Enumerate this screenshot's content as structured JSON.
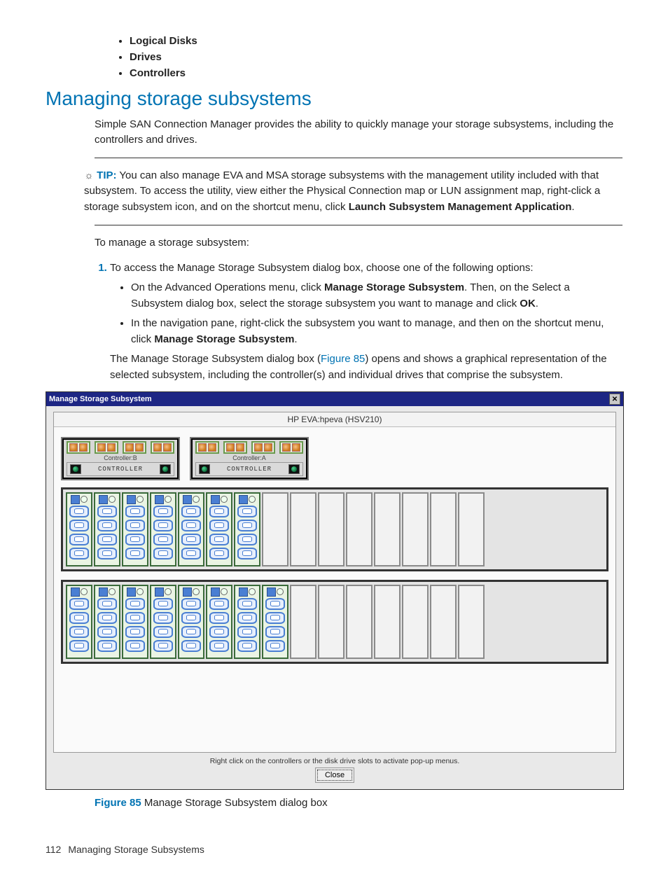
{
  "top_bullets": [
    "Logical Disks",
    "Drives",
    "Controllers"
  ],
  "heading": "Managing storage subsystems",
  "intro": "Simple SAN Connection Manager provides the ability to quickly manage your storage subsystems, including the controllers and drives.",
  "tip": {
    "label": "TIP:",
    "pre": "You can also manage EVA and MSA storage subsystems with the management utility included with that subsystem. To access the utility, view either the Physical Connection map or LUN assignment map, right-click a storage subsystem icon, and on the shortcut menu, click ",
    "bold": "Launch Subsystem Management Application",
    "post": "."
  },
  "lead": "To manage a storage subsystem:",
  "step1": "To access the Manage Storage Subsystem dialog box, choose one of the following options:",
  "sub1": {
    "a": "On the Advanced Operations menu, click ",
    "b": "Manage Storage Subsystem",
    "c": ". Then, on the Select a Subsystem dialog box, select the storage subsystem you want to manage and click ",
    "d": "OK",
    "e": "."
  },
  "sub2": {
    "a": "In the navigation pane, right-click the subsystem you want to manage, and then on the shortcut menu, click ",
    "b": "Manage Storage Subsystem",
    "c": "."
  },
  "paraAfter": {
    "a": "The Manage Storage Subsystem dialog box (",
    "link": "Figure 85",
    "b": ") opens and shows a graphical representation of the selected subsystem, including the controller(s) and individual drives that comprise the subsystem."
  },
  "dialog": {
    "title": "Manage Storage Subsystem",
    "device": "HP EVA:hpeva (HSV210)",
    "controllers": [
      {
        "sublabel": "Controller:B",
        "barlabel": "CONTROLLER"
      },
      {
        "sublabel": "Controller:A",
        "barlabel": "CONTROLLER"
      }
    ],
    "shelves": [
      {
        "filled": 7,
        "empty": 8
      },
      {
        "filled": 8,
        "empty": 7
      }
    ],
    "hint": "Right click on the controllers or the disk drive slots to activate pop-up menus.",
    "close": "Close"
  },
  "caption": {
    "num": "Figure 85",
    "text": " Manage Storage Subsystem dialog box"
  },
  "footer": {
    "page": "112",
    "chapter": "Managing Storage Subsystems"
  }
}
